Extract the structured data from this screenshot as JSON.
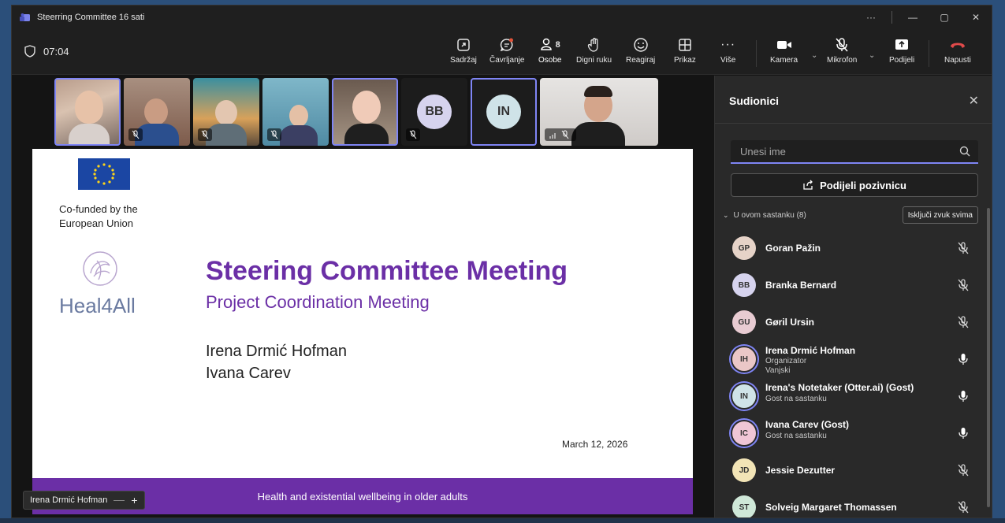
{
  "window": {
    "title": "Steerring Committee 16 sati"
  },
  "toolbar": {
    "timer": "07:04",
    "items": [
      {
        "label": "Sadržaj",
        "icon": "share-content-icon"
      },
      {
        "label": "Čavrljanje",
        "icon": "chat-icon"
      },
      {
        "label": "Osobe",
        "icon": "people-icon",
        "count": "8"
      },
      {
        "label": "Digni ruku",
        "icon": "raise-hand-icon"
      },
      {
        "label": "Reagiraj",
        "icon": "react-smiley-icon"
      },
      {
        "label": "Prikaz",
        "icon": "view-grid-icon"
      },
      {
        "label": "Više",
        "icon": "more-icon"
      },
      {
        "label": "Kamera",
        "icon": "camera-icon"
      },
      {
        "label": "Mikrofon",
        "icon": "mic-off-icon"
      },
      {
        "label": "Podijeli",
        "icon": "share-screen-icon"
      },
      {
        "label": "Napusti",
        "icon": "hang-up-icon"
      }
    ]
  },
  "strip": {
    "avatar_bb": "BB",
    "avatar_in": "IN"
  },
  "slide": {
    "cofunded_line1": "Co-funded by the",
    "cofunded_line2": "European Union",
    "logo_text": "Heal4All",
    "title": "Steering Committee Meeting",
    "subtitle": "Project Coordination Meeting",
    "name1": "Irena Drmić Hofman",
    "name2": "Ivana Carev",
    "date": "March 12, 2026",
    "footer": "Health and existential wellbeing in older adults"
  },
  "presenter": {
    "name": "Irena Drmić Hofman"
  },
  "panel": {
    "title": "Sudionici",
    "search_placeholder": "Unesi ime",
    "share_invite": "Podijeli pozivnicu",
    "section_label": "U ovom sastanku (8)",
    "mute_all": "Isključi zvuk svima",
    "people": [
      {
        "initials": "GP",
        "name": "Goran Pažin",
        "color": "#e6d3c8",
        "mic": "off"
      },
      {
        "initials": "BB",
        "name": "Branka Bernard",
        "color": "#d6d3ee",
        "mic": "off"
      },
      {
        "initials": "GU",
        "name": "Gøril Ursin",
        "color": "#e8cbd2",
        "mic": "off"
      },
      {
        "initials": "IH",
        "name": "Irena Drmić Hofman",
        "sub1": "Organizator",
        "sub2": "Vanjski",
        "color": "#eac7c7",
        "mic": "on"
      },
      {
        "initials": "IN",
        "name": "Irena's Notetaker (Otter.ai) (Gost)",
        "sub1": "Gost na sastanku",
        "color": "#cfe3e8",
        "mic": "on"
      },
      {
        "initials": "IC",
        "name": "Ivana Carev (Gost)",
        "sub1": "Gost na sastanku",
        "color": "#efc6d6",
        "mic": "on"
      },
      {
        "initials": "JD",
        "name": "Jessie Dezutter",
        "color": "#f2e4b6",
        "mic": "off"
      },
      {
        "initials": "ST",
        "name": "Solveig Margaret Thomassen",
        "color": "#cfe8d8",
        "mic": "off"
      }
    ]
  }
}
